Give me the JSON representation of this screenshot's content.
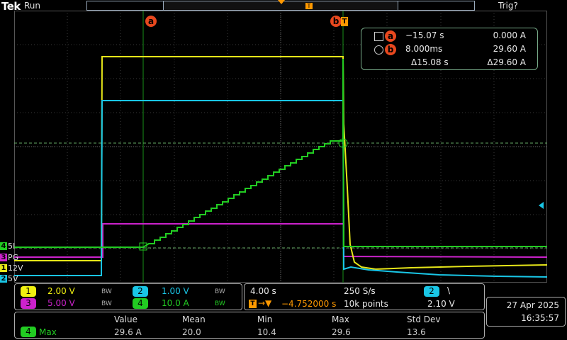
{
  "header": {
    "brand": "Tek",
    "run_state": "Run",
    "trigger_state": "Trig?",
    "record_view_marker": "T"
  },
  "cursors": {
    "a_label": "a",
    "b_label": "b",
    "trigger_marker": "T",
    "readout": {
      "row_a": {
        "label": "a",
        "time": "−15.07 s",
        "value": "0.000 A"
      },
      "row_b": {
        "label": "b",
        "time": "8.000ms",
        "value": "29.60 A"
      },
      "row_delta": {
        "time": "Δ15.08 s",
        "value": "Δ29.60 A"
      }
    }
  },
  "channel_markers": [
    {
      "num": "4",
      "text": "5I",
      "color": "#22cc22"
    },
    {
      "num": "3",
      "text": "PG",
      "color": "#cc22cc"
    },
    {
      "num": "1",
      "text": "12V",
      "color": "#e6e619"
    },
    {
      "num": "2",
      "text": "5V",
      "color": "#19c6e6"
    }
  ],
  "channels": {
    "ch1": {
      "num": "1",
      "scale": "2.00 V",
      "bw": "BW",
      "color": "#f0f010"
    },
    "ch2": {
      "num": "2",
      "scale": "1.00 V",
      "bw": "BW",
      "color": "#19c6e6"
    },
    "ch3": {
      "num": "3",
      "scale": "5.00 V",
      "bw": "BW",
      "color": "#cc22cc"
    },
    "ch4": {
      "num": "4",
      "scale": "10.0 A",
      "bw": "BW",
      "color": "#22cc22"
    }
  },
  "timebase": {
    "scale": "4.00 s",
    "rate": "250 S/s",
    "trigger_pos": "−4.752000 s",
    "record": "10k points",
    "trig_channel": "2",
    "trig_slope": "\\",
    "trig_level": "2.10 V"
  },
  "datetime": {
    "date": "27 Apr  2025",
    "time": "16:35:57"
  },
  "measurement": {
    "headers": [
      "Value",
      "Mean",
      "Min",
      "Max",
      "Std Dev"
    ],
    "channel": "4",
    "name": "Max",
    "values": [
      "29.6 A",
      "20.0",
      "10.4",
      "29.6",
      "13.6"
    ]
  },
  "colors": {
    "ch1": "#f0f010",
    "ch2": "#19c6e6",
    "ch3": "#cc22cc",
    "ch4": "#22cc22",
    "cursor": "#e8481e",
    "trigger": "#ff9900"
  }
}
